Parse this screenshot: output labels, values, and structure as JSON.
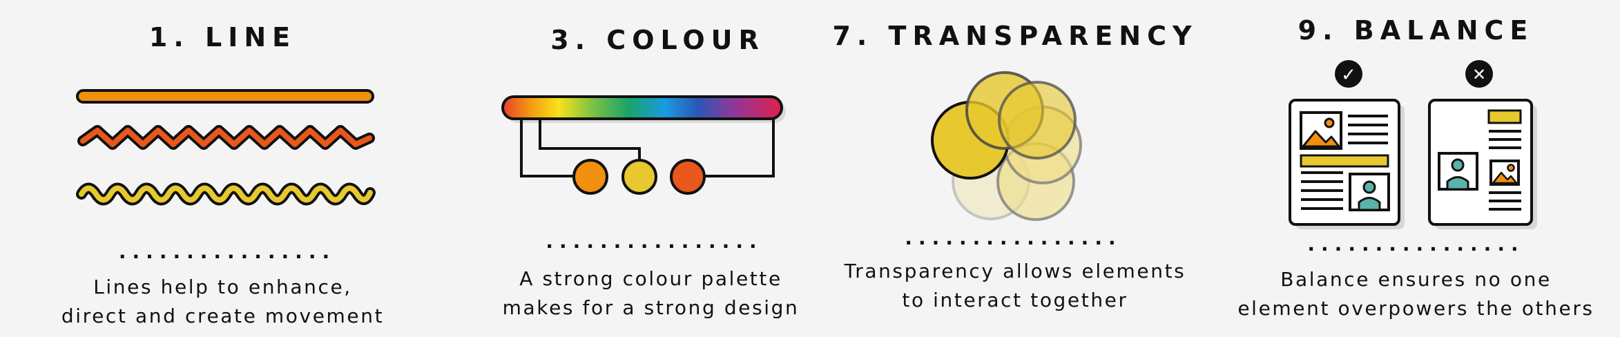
{
  "panels": [
    {
      "title": "1. LINE",
      "dots": "................",
      "desc": [
        "Lines help to enhance,",
        "direct and create movement"
      ],
      "icons": [
        "straight-line",
        "zigzag-line",
        "wavy-line"
      ]
    },
    {
      "title": "3. COLOUR",
      "dots": "................",
      "desc": [
        "A strong colour palette",
        "makes for a strong design"
      ],
      "icons": [
        "rainbow-bar",
        "colour-swatch-circles"
      ]
    },
    {
      "title": "7. TRANSPARENCY",
      "dots": "................",
      "desc": [
        "Transparency allows elements",
        "to interact together"
      ],
      "icons": [
        "overlapping-circles"
      ]
    },
    {
      "title": "9. BALANCE",
      "dots": "................",
      "desc": [
        "Balance ensures no one",
        "element overpowers the others"
      ],
      "good_mark": "✓",
      "bad_mark": "✕",
      "icons": [
        "balanced-layout",
        "unbalanced-layout"
      ]
    }
  ],
  "colors": {
    "background": "#f4f4f4",
    "orange": "#f0900e",
    "red_orange": "#e8571c",
    "yellow": "#e7c82e",
    "pale_yellow": "#efdd86",
    "teal": "#5ab3ad",
    "outline": "#111111"
  }
}
